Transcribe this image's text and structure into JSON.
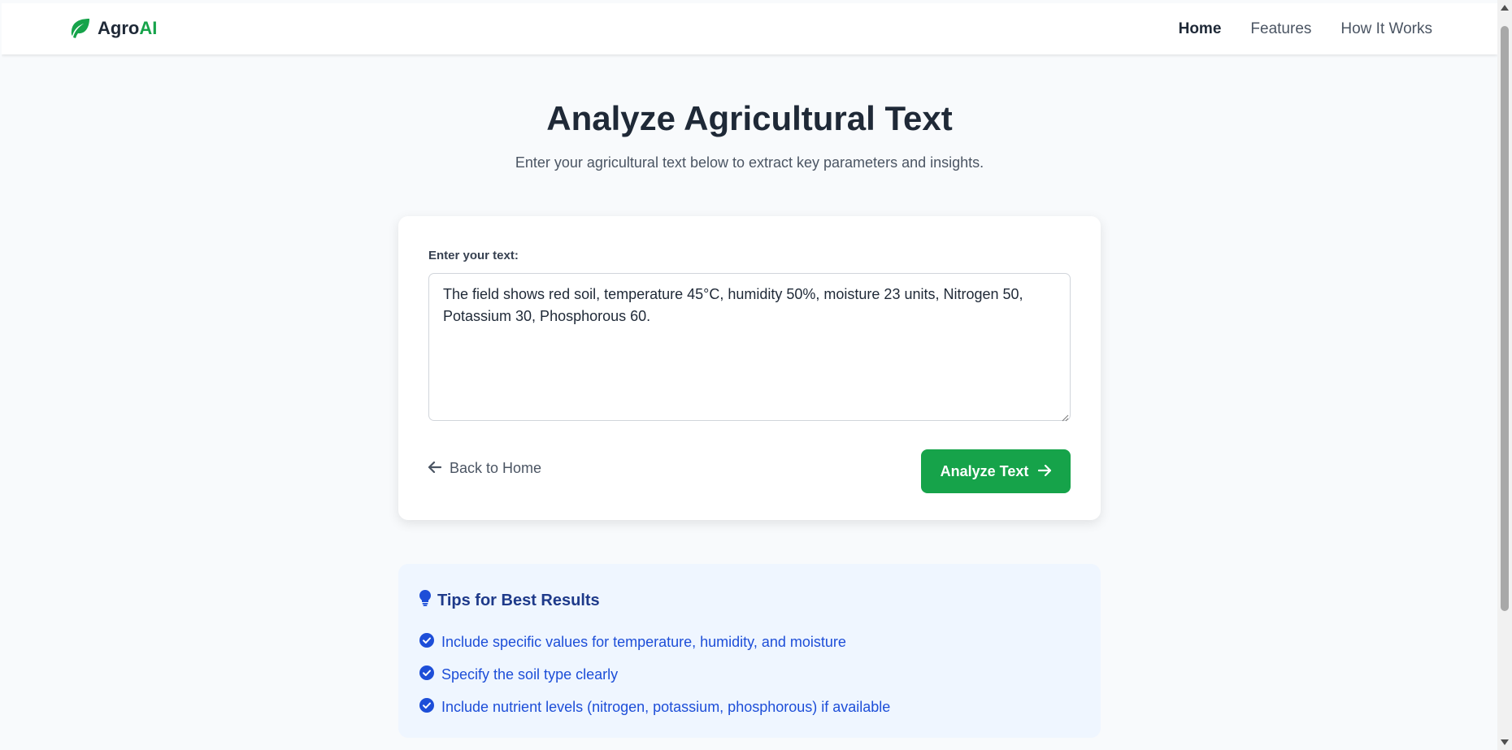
{
  "brand": {
    "name_part1": "Agro",
    "name_part2": "AI",
    "icon": "leaf-icon",
    "accent_color": "#16a34a"
  },
  "nav": {
    "items": [
      {
        "label": "Home",
        "active": true
      },
      {
        "label": "Features",
        "active": false
      },
      {
        "label": "How It Works",
        "active": false
      }
    ]
  },
  "main": {
    "title": "Analyze Agricultural Text",
    "subtitle": "Enter your agricultural text below to extract key parameters and insights."
  },
  "form": {
    "label": "Enter your text:",
    "text_value": "The field shows red soil, temperature 45°C, humidity 50%, moisture 23 units, Nitrogen 50, Potassium 30, Phosphorous 60.",
    "back_label": "Back to Home",
    "back_icon": "arrow-left-icon",
    "submit_label": "Analyze Text",
    "submit_icon": "arrow-right-icon",
    "submit_color": "#16a34a"
  },
  "tips": {
    "title": "Tips for Best Results",
    "title_icon": "lightbulb-icon",
    "item_icon": "check-circle-icon",
    "items": [
      "Include specific values for temperature, humidity, and moisture",
      "Specify the soil type clearly",
      "Include nutrient levels (nitrogen, potassium, phosphorous) if available"
    ],
    "background_color": "#eff6ff",
    "text_color": "#1d4ed8"
  }
}
